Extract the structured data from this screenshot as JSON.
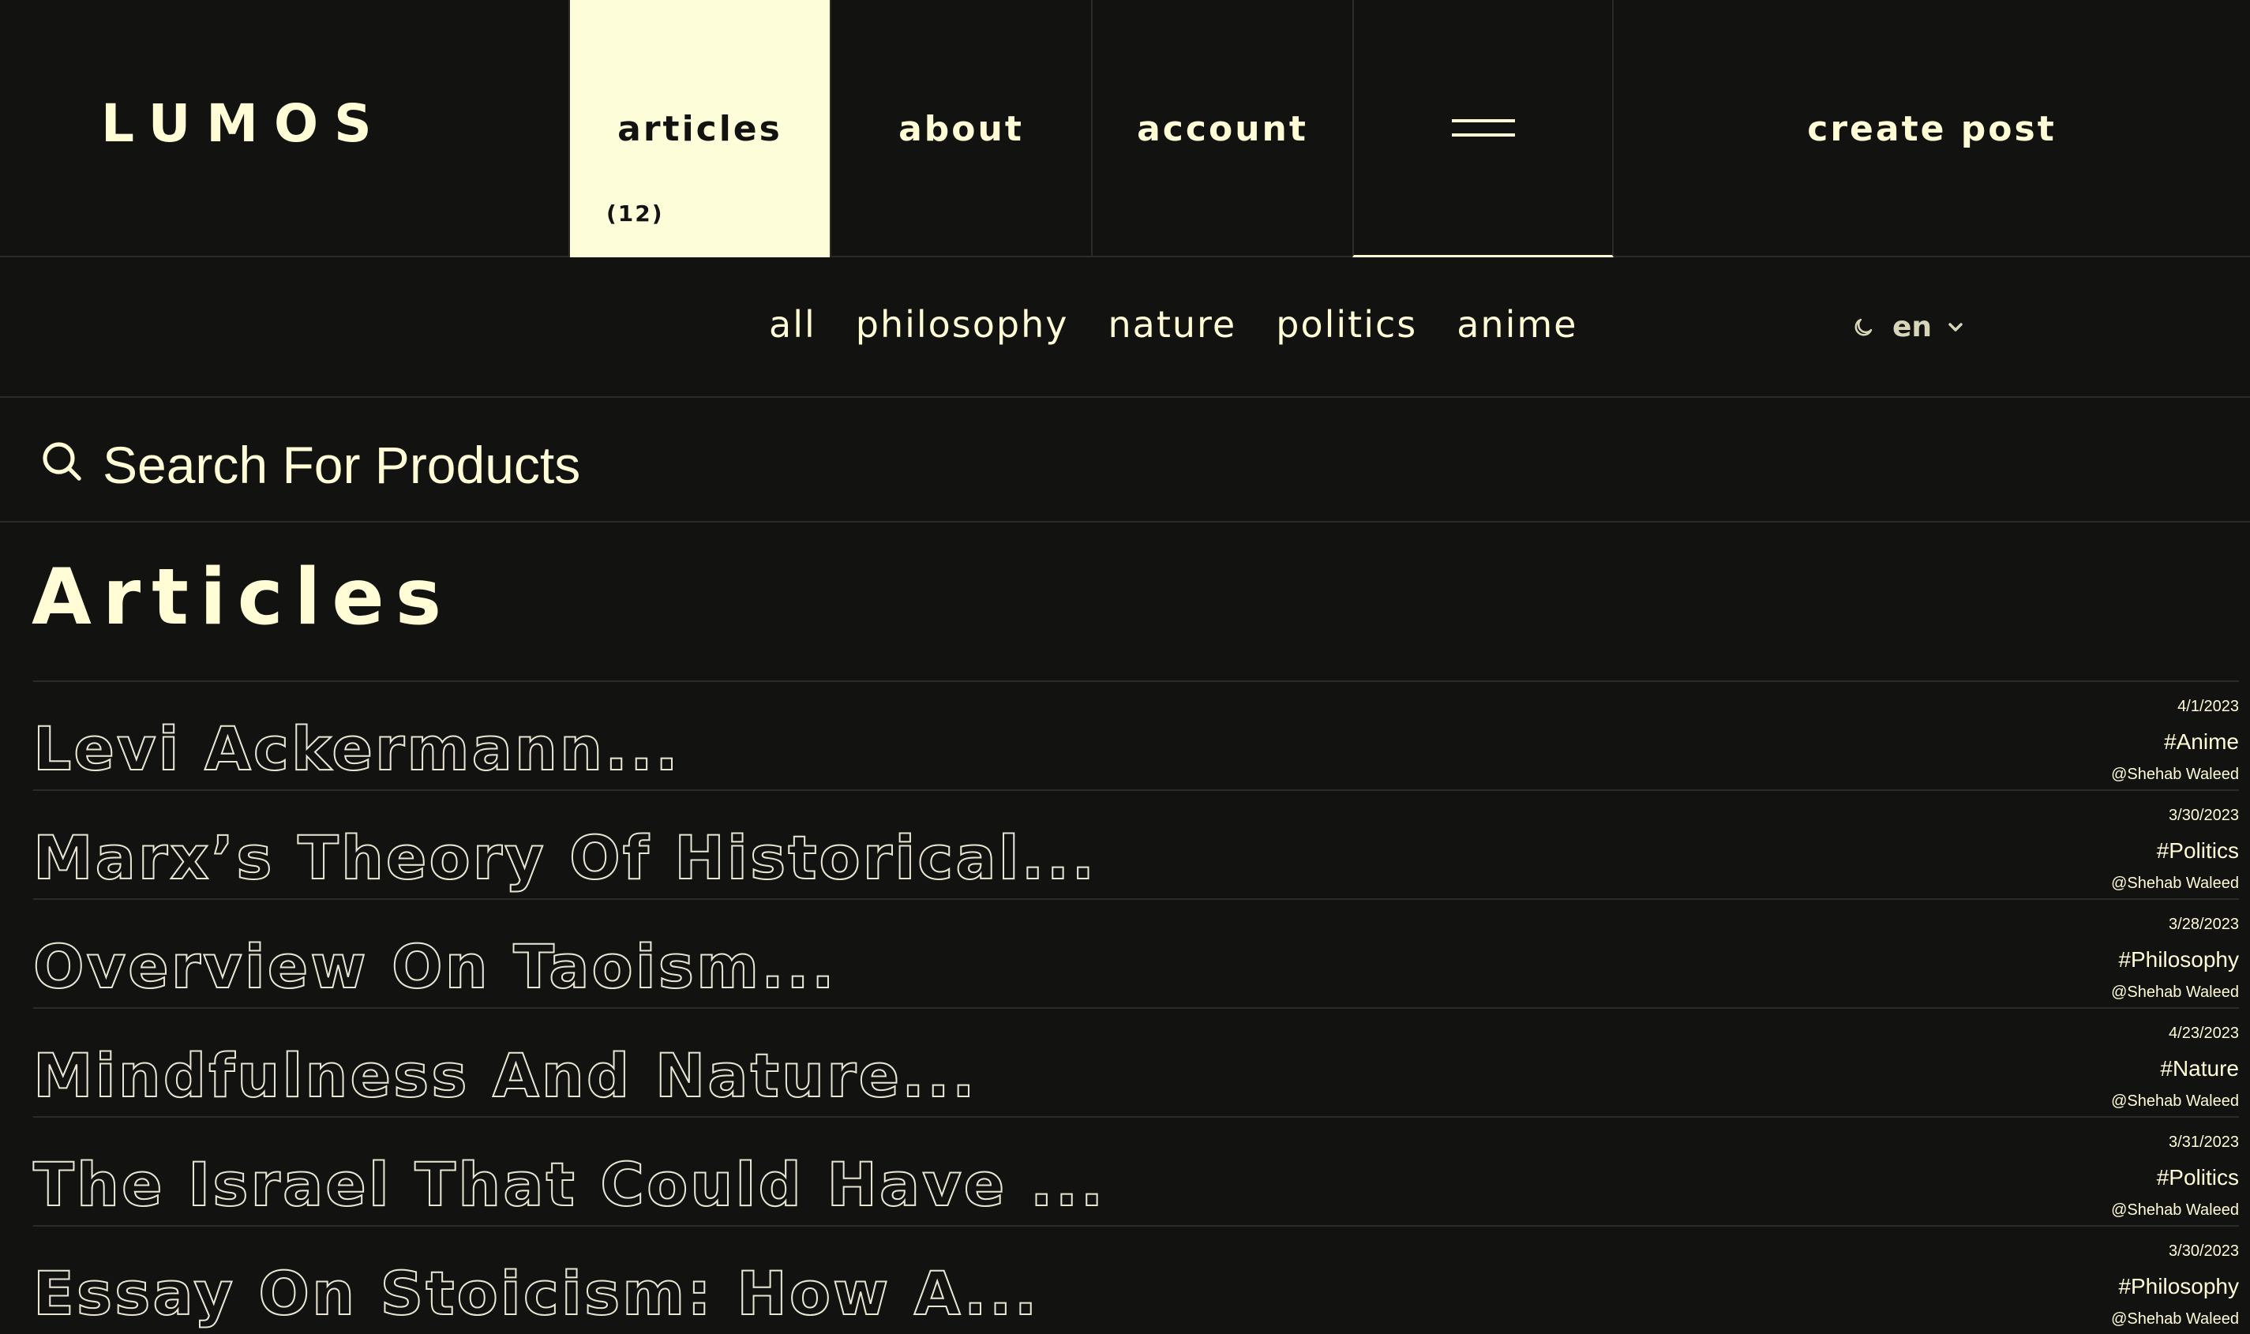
{
  "brand": {
    "logo": "LUMOS"
  },
  "nav": {
    "articles_label": "articles",
    "articles_count": "(12)",
    "about_label": "about",
    "account_label": "account",
    "create_post_label": "create post"
  },
  "categories": [
    "all",
    "philosophy",
    "nature",
    "politics",
    "anime"
  ],
  "prefs": {
    "language": "en",
    "theme_icon": "moon-icon"
  },
  "search": {
    "placeholder": "Search For Products"
  },
  "page": {
    "title": "Articles"
  },
  "articles": [
    {
      "title": "Levi Ackermann...",
      "date": "4/1/2023",
      "tag": "#Anime",
      "author": "@Shehab Waleed"
    },
    {
      "title": "Marx’s Theory Of Historical...",
      "date": "3/30/2023",
      "tag": "#Politics",
      "author": "@Shehab Waleed"
    },
    {
      "title": "Overview On Taoism...",
      "date": "3/28/2023",
      "tag": "#Philosophy",
      "author": "@Shehab Waleed"
    },
    {
      "title": "Mindfulness And Nature...",
      "date": "4/23/2023",
      "tag": "#Nature",
      "author": "@Shehab Waleed"
    },
    {
      "title": "The Israel That Could Have ...",
      "date": "3/31/2023",
      "tag": "#Politics",
      "author": "@Shehab Waleed"
    },
    {
      "title": "Essay On Stoicism: How A...",
      "date": "3/30/2023",
      "tag": "#Philosophy",
      "author": "@Shehab Waleed"
    }
  ],
  "colors": {
    "background": "#121211",
    "accent": "#fdfed9",
    "text": "#fffcd6",
    "divider": "#2b2b29"
  }
}
